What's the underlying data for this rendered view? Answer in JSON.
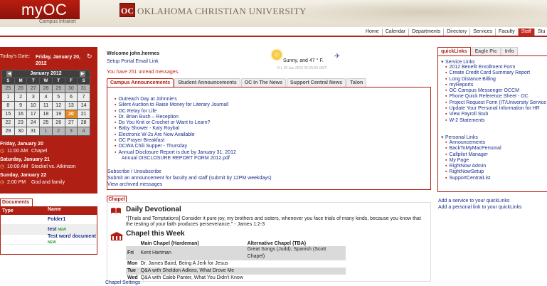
{
  "header": {
    "brand": "myOC",
    "brand_sub": "Campus Intranet",
    "logo_letters": "OC",
    "university_name": "OKLAHOMA CHRISTIAN UNIVERSITY"
  },
  "nav": [
    "Home",
    "Calendar",
    "Departments",
    "Directory",
    "Services",
    "Faculty",
    "Staff",
    "Stu"
  ],
  "nav_active": "Staff",
  "today": {
    "label": "Today's Date:",
    "date": "Friday, January 20, 2012"
  },
  "calendar": {
    "month": "January 2012",
    "dow": [
      "S",
      "M",
      "T",
      "W",
      "T",
      "F",
      "S"
    ],
    "days": [
      {
        "n": "25",
        "o": true
      },
      {
        "n": "26",
        "o": true
      },
      {
        "n": "27",
        "o": true
      },
      {
        "n": "28",
        "o": true
      },
      {
        "n": "29",
        "o": true
      },
      {
        "n": "30",
        "o": true
      },
      {
        "n": "31",
        "o": true
      },
      {
        "n": "1"
      },
      {
        "n": "2"
      },
      {
        "n": "3"
      },
      {
        "n": "4"
      },
      {
        "n": "5"
      },
      {
        "n": "6"
      },
      {
        "n": "7"
      },
      {
        "n": "8"
      },
      {
        "n": "9"
      },
      {
        "n": "10"
      },
      {
        "n": "11"
      },
      {
        "n": "12"
      },
      {
        "n": "13"
      },
      {
        "n": "14"
      },
      {
        "n": "15"
      },
      {
        "n": "16"
      },
      {
        "n": "17"
      },
      {
        "n": "18"
      },
      {
        "n": "19"
      },
      {
        "n": "20",
        "t": true
      },
      {
        "n": "21"
      },
      {
        "n": "22"
      },
      {
        "n": "23"
      },
      {
        "n": "24"
      },
      {
        "n": "25"
      },
      {
        "n": "26"
      },
      {
        "n": "27"
      },
      {
        "n": "28"
      },
      {
        "n": "29"
      },
      {
        "n": "30"
      },
      {
        "n": "31"
      },
      {
        "n": "1",
        "o": true
      },
      {
        "n": "2",
        "o": true
      },
      {
        "n": "3",
        "o": true
      },
      {
        "n": "4",
        "o": true
      }
    ]
  },
  "events": [
    {
      "day": "Friday, January 20",
      "items": [
        {
          "time": "11:00 AM",
          "title": "Chapel"
        }
      ]
    },
    {
      "day": "Saturday, January 21",
      "items": [
        {
          "time": "10:00 AM",
          "title": "Stockel vs. Atkinson"
        }
      ]
    },
    {
      "day": "Sunday, January 22",
      "items": [
        {
          "time": "2:00 PM",
          "title": "God and family"
        }
      ]
    }
  ],
  "documents": {
    "tab": "Documents",
    "col_type": "Type",
    "col_name": "Name",
    "rows": [
      {
        "type": "",
        "name": "Folder1",
        "new": ""
      },
      {
        "type": "",
        "name": "test",
        "new": "NEW"
      },
      {
        "type": "",
        "name": "Test word document",
        "new": "NEW"
      }
    ]
  },
  "welcome": {
    "greeting": "Welcome john.hermes",
    "links": "Setup Portal Email Link",
    "unread": "You have 251 unread messages."
  },
  "weather": {
    "text": "Sunny, and 47 ° F.",
    "date": "Fri, 20 Jan 2012 22:25:00 GMT"
  },
  "center_tabs": [
    "Campus Announcements",
    "Student Announcements",
    "OC In The News",
    "Support Central News",
    "Talon"
  ],
  "center_tab_active": "Campus Announcements",
  "announcements": [
    "Outreach Day at Johnnie's",
    "Silent Auction to Raise Money for Literary Journal!",
    "OC Relay for Life",
    "Dr. Brian Bush – Reception",
    "Do You Knit or Crochet or Want to Learn?",
    "Baby Shower - Katy Roybal",
    "Electronic W-2s Are Now Available",
    "OC Prayer Breakfast",
    "OCWA Chili Supper - Thursday",
    "Annual Disclosure Report is due by January 31, 2012"
  ],
  "announcement_sub": "Annual DISCLOSURE REPORT FORM 2012.pdf",
  "announcement_footer": {
    "subscribe": "Subscribe / Unsubscribe",
    "submit": "Submit an announcement for faculty and staff (submit by 12PM weekdays)",
    "archived": "View archived messages"
  },
  "chapel": {
    "tab": "Chapel",
    "devotional_title": "Daily Devotional",
    "devotional_text": "\"[Trials and Temptations] Consider it pure joy, my brothers and sisters, whenever you face trials of many kinds, because you know that the testing of your faith produces perseverance.\" - James 1:2-3",
    "week_title": "Chapel this Week",
    "col_main": "Main Chapel (Hardeman)",
    "col_alt": "Alternative Chapel (TBA)",
    "rows": [
      {
        "day": "Fri",
        "main": "Kent Hartman",
        "alt": "Great Songs (Judd); Spanish (Scott Chapel)",
        "gray": true
      },
      {
        "day": "Mon",
        "main": "Dr. James Baird, Being A Jerk for Jesus",
        "alt": "",
        "gray": false
      },
      {
        "day": "Tue",
        "main": "Q&A with Sheldon Adkins, What Drove Me",
        "alt": "",
        "gray": true
      },
      {
        "day": "Wed",
        "main": "Q&A with Caleb Panter, What You Didn't Know",
        "alt": "",
        "gray": false
      }
    ],
    "settings": "Chapel Settings"
  },
  "right_tabs": [
    "quickLinks",
    "Eagle Pic",
    "Info"
  ],
  "right_tab_active": "quickLinks",
  "service_links": {
    "heading": "Service Links",
    "items": [
      "2012 Benefit Enrollment Form",
      "Create Credit Card Summary Report",
      "Long Distance Billing",
      "myReports",
      "OC Campus Messenger OCCM",
      "Phone Quick Reference Sheet - OC",
      "Project Request Form (IT/University Service",
      "Update Your Personal Information for HR",
      "View Payroll Stub",
      "W-2 Statements"
    ]
  },
  "personal_links": {
    "heading": "Personal Links",
    "items": [
      "Announcements",
      "BackToMyMacPersonal",
      "Callpilot Manager",
      "My Page",
      "RightNow Admin",
      "RightNowSetup",
      "SupportCentralList"
    ]
  },
  "quicklinks_add": {
    "service": "Add a service to your quickLinks",
    "personal": "Add a personal link to your quickLinks"
  },
  "colors": {
    "brand_red": "#b01f14",
    "link_blue": "#1a2f8a",
    "today_orange": "#e98a1e"
  }
}
